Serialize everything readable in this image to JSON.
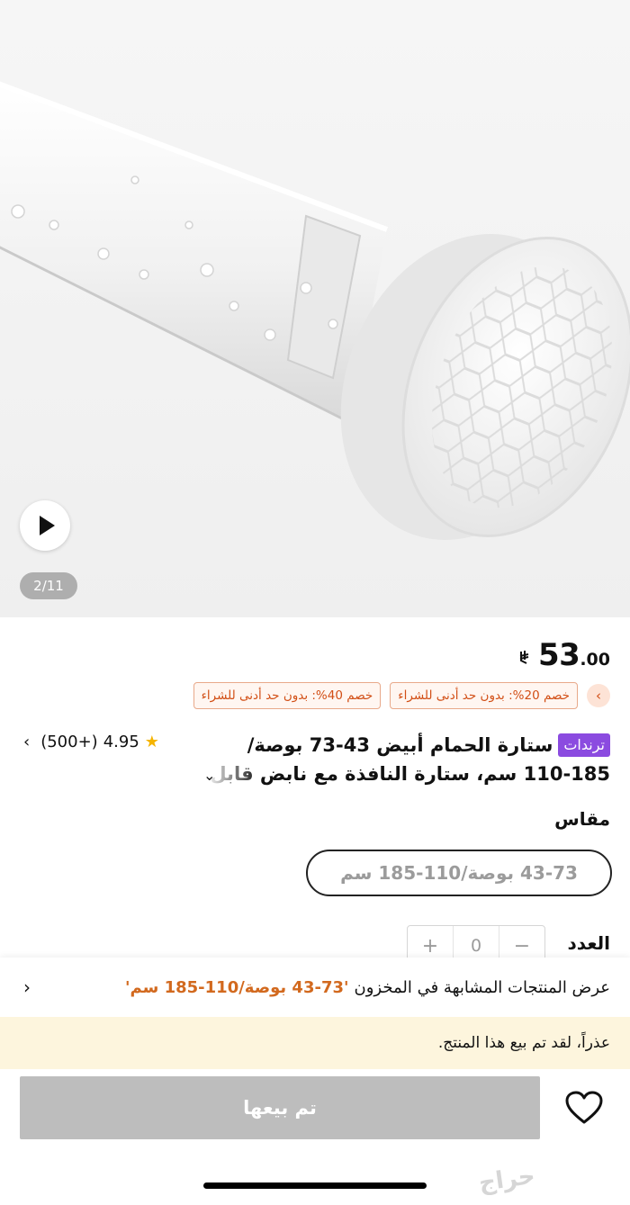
{
  "gallery": {
    "counter": "2/11",
    "play_icon": "play-icon"
  },
  "price": {
    "currency_symbol": "⃁",
    "integer": "53",
    "decimal": ".00"
  },
  "coupons": [
    "خصم 40%: بدون حد أدنى للشراء",
    "خصم 20%: بدون حد أدنى للشراء"
  ],
  "product": {
    "badge": "ترندات",
    "title_line1": "ستارة الحمام أبيض 43-73 بوصة/",
    "title_line2": "110-185 سم، ستارة النافذة مع نابض قابل"
  },
  "rating": {
    "score": "4.95",
    "count": "(500+)"
  },
  "size": {
    "label": "مقاس",
    "selected": "43-73 بوصة/110-185 سم"
  },
  "quantity": {
    "label": "العدد",
    "value": "0",
    "minus": "−",
    "plus": "+"
  },
  "similar": {
    "text": "عرض المنتجات المشابهة في المخزون",
    "highlight": "'43-73 بوصة/110-185 سم'"
  },
  "notice": {
    "text": "عذراً، لقد تم بيع هذا المنتج."
  },
  "actions": {
    "sold_label": "تم بيعها"
  },
  "watermark": "حراج",
  "colors": {
    "accent_orange": "#d24f16",
    "badge_purple": "#8b4be0",
    "notice_bg": "#fdf5dd",
    "disabled_button": "#bdbdbd"
  }
}
